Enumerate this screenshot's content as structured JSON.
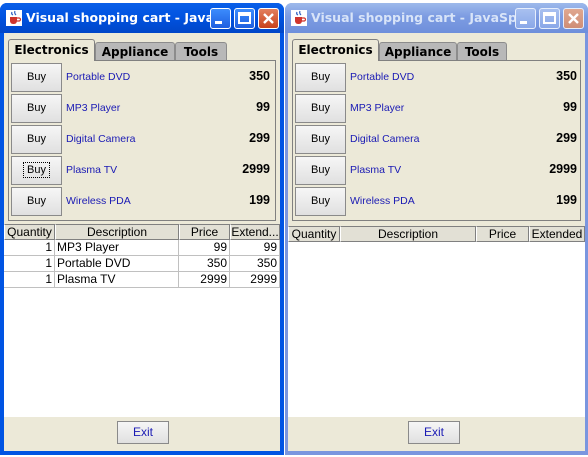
{
  "windows": [
    {
      "title": "Visual shopping cart - Java...",
      "tabs": [
        "Electronics",
        "Appliance",
        "Tools"
      ],
      "selected_tab": 0,
      "products": [
        {
          "buy": "Buy",
          "name": "Portable DVD",
          "price": "350"
        },
        {
          "buy": "Buy",
          "name": "MP3 Player",
          "price": "99"
        },
        {
          "buy": "Buy",
          "name": "Digital Camera",
          "price": "299"
        },
        {
          "buy": "Buy",
          "name": "Plasma TV",
          "price": "2999"
        },
        {
          "buy": "Buy",
          "name": "Wireless PDA",
          "price": "199"
        }
      ],
      "columns": [
        "Quantity",
        "Description",
        "Price",
        "Extend..."
      ],
      "rows": [
        [
          "1",
          "MP3 Player",
          "99",
          "99"
        ],
        [
          "1",
          "Portable DVD",
          "350",
          "350"
        ],
        [
          "1",
          "Plasma TV",
          "2999",
          "2999"
        ]
      ],
      "exit_label": "Exit"
    },
    {
      "title": "Visual shopping cart - JavaSpa...",
      "tabs": [
        "Electronics",
        "Appliance",
        "Tools"
      ],
      "selected_tab": 0,
      "products": [
        {
          "buy": "Buy",
          "name": "Portable DVD",
          "price": "350"
        },
        {
          "buy": "Buy",
          "name": "MP3 Player",
          "price": "99"
        },
        {
          "buy": "Buy",
          "name": "Digital Camera",
          "price": "299"
        },
        {
          "buy": "Buy",
          "name": "Plasma TV",
          "price": "2999"
        },
        {
          "buy": "Buy",
          "name": "Wireless PDA",
          "price": "199"
        }
      ],
      "columns": [
        "Quantity",
        "Description",
        "Price",
        "Extended"
      ],
      "rows": [],
      "exit_label": "Exit"
    }
  ],
  "colors": {
    "active_title": "#0054e3",
    "inactive_title": "#7a96df",
    "product_link": "#1a1ab4",
    "panel": "#ece9d8"
  }
}
